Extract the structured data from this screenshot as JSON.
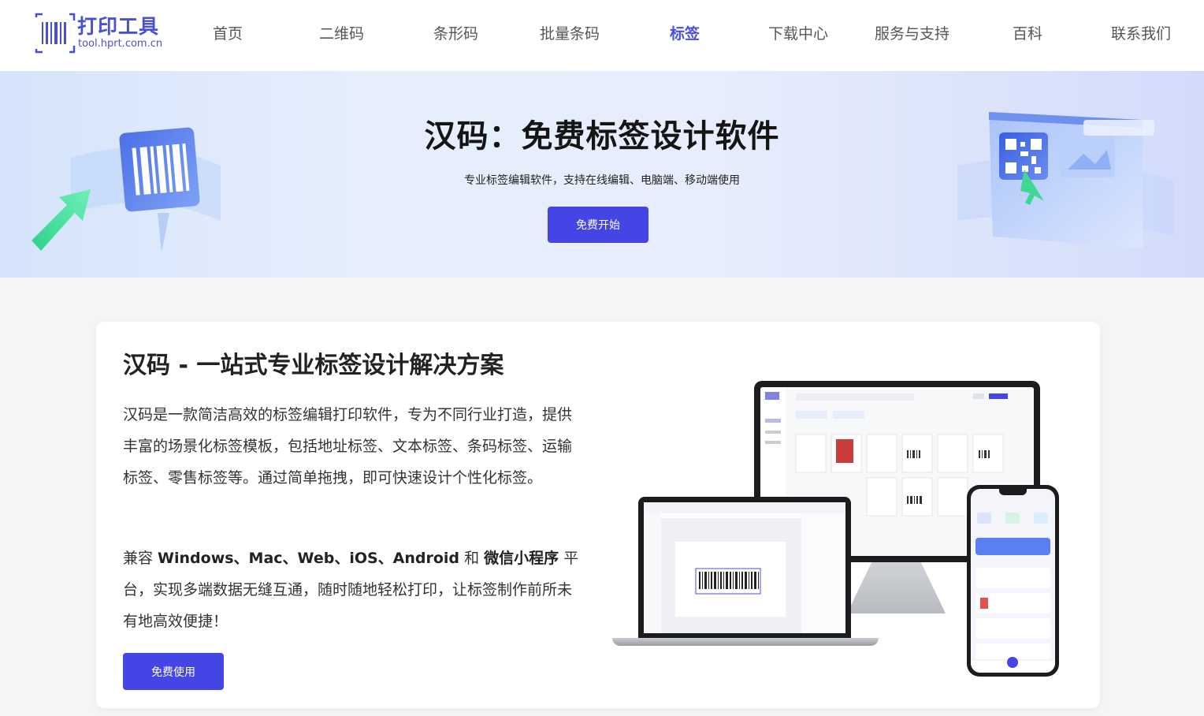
{
  "header": {
    "logo_main": "打印工具",
    "logo_sub": "tool.hprt.com.cn",
    "nav": [
      {
        "label": "首页",
        "active": false
      },
      {
        "label": "二维码",
        "active": false
      },
      {
        "label": "条形码",
        "active": false
      },
      {
        "label": "批量条码",
        "active": false
      },
      {
        "label": "标签",
        "active": true
      },
      {
        "label": "下载中心",
        "active": false
      },
      {
        "label": "服务与支持",
        "active": false
      },
      {
        "label": "百科",
        "active": false
      },
      {
        "label": "联系我们",
        "active": false
      }
    ]
  },
  "hero": {
    "title": "汉码：免费标签设计软件",
    "subtitle": "专业标签编辑软件，支持在线编辑、电脑端、移动端使用",
    "button": "免费开始"
  },
  "card": {
    "title": "汉码 - 一站式专业标签设计解决方案",
    "paragraph1": "汉码是一款简洁高效的标签编辑打印软件，专为不同行业打造，提供丰富的场景化标签模板，包括地址标签、文本标签、条码标签、运输标签、零售标签等。通过简单拖拽，即可快速设计个性化标签。",
    "p2_prefix": "兼容 ",
    "p2_platforms": "Windows、Mac、Web、iOS、Android",
    "p2_and": " 和 ",
    "p2_mini": "微信小程序",
    "p2_suffix": " 平台，实现多端数据无缝互通，随时随地轻松打印，让标签制作前所未有地高效便捷！",
    "button": "免费使用"
  },
  "colors": {
    "brand": "#4545e6",
    "active_nav": "#4a4fe0"
  }
}
